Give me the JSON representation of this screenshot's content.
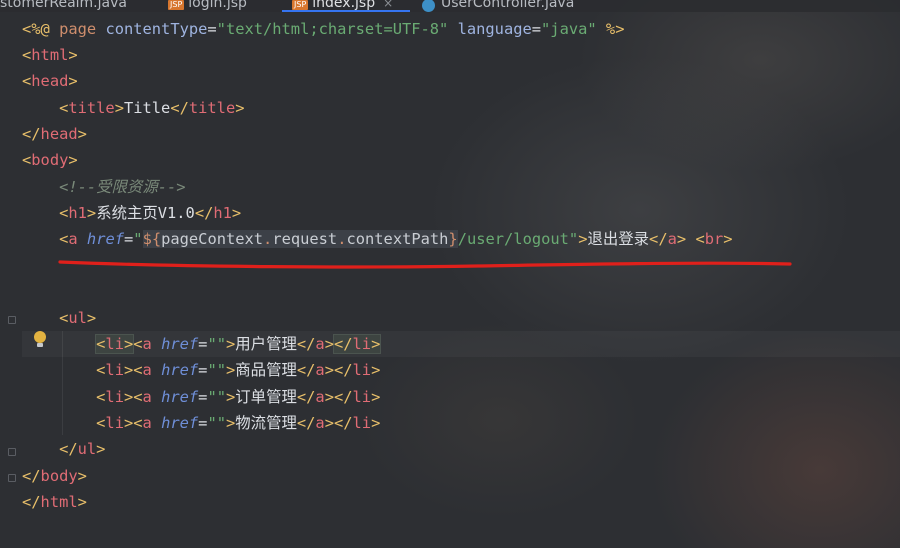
{
  "tabs": [
    {
      "label": "stomerRealm.java",
      "type": "java"
    },
    {
      "label": "login.jsp",
      "type": "jsp",
      "badge": "JSP"
    },
    {
      "label": "index.jsp",
      "type": "jsp",
      "badge": "JSP",
      "active": true,
      "close": "×"
    },
    {
      "label": "UserController.java",
      "type": "class"
    }
  ],
  "code": {
    "l1": {
      "lt": "<%@",
      "page": "page",
      "ct_attr": "contentType",
      "eq1": "=",
      "ct_val": "\"text/html;charset=UTF-8\"",
      "lang_attr": "language",
      "eq2": "=",
      "lang_val": "\"java\"",
      "end": "%>"
    },
    "l2": {
      "open": "<",
      "name": "html",
      "close": ">"
    },
    "l3": {
      "open": "<",
      "name": "head",
      "close": ">"
    },
    "l4": {
      "open": "<",
      "name": "title",
      "close": ">",
      "text": "Title",
      "eopen": "</",
      "ename": "title",
      "eclose": ">"
    },
    "l5": {
      "open": "</",
      "name": "head",
      "close": ">"
    },
    "l6": {
      "open": "<",
      "name": "body",
      "close": ">"
    },
    "l7": {
      "comment": "<!--受限资源-->"
    },
    "l8": {
      "open": "<",
      "name": "h1",
      "close": ">",
      "text": "系统主页V1.0",
      "eopen": "</",
      "ename": "h1",
      "eclose": ">"
    },
    "l9": {
      "open": "<",
      "name": "a",
      "attr": "href",
      "eq": "=",
      "q1": "\"",
      "el_open": "${",
      "expr1": "pageContext",
      "dot1": ".",
      "expr2": "request",
      "dot2": ".",
      "expr3": "contextPath",
      "el_close": "}",
      "path": "/user/logout",
      "q2": "\"",
      "close": ">",
      "text": "退出登录",
      "eopen": "</",
      "ename": "a",
      "eclose": ">",
      "br_open": "<",
      "br": "br",
      "br_close": ">"
    },
    "l12": {
      "open": "<",
      "name": "ul",
      "close": ">"
    },
    "items": [
      {
        "text": "用户管理"
      },
      {
        "text": "商品管理"
      },
      {
        "text": "订单管理"
      },
      {
        "text": "物流管理"
      }
    ],
    "li": {
      "open": "<",
      "name": "li",
      "close": ">",
      "eopen": "</",
      "a": "a",
      "attr": "href",
      "eq": "=",
      "val": "\"\""
    },
    "l17": {
      "open": "</",
      "name": "ul",
      "close": ">"
    },
    "l18": {
      "open": "</",
      "name": "body",
      "close": ">"
    },
    "l19": {
      "open": "</",
      "name": "html",
      "close": ">"
    }
  },
  "colors": {
    "annotation": "#e0201b",
    "tag": "#e8bf6a",
    "string": "#6aab73",
    "attribute": "#6f8fd8"
  }
}
